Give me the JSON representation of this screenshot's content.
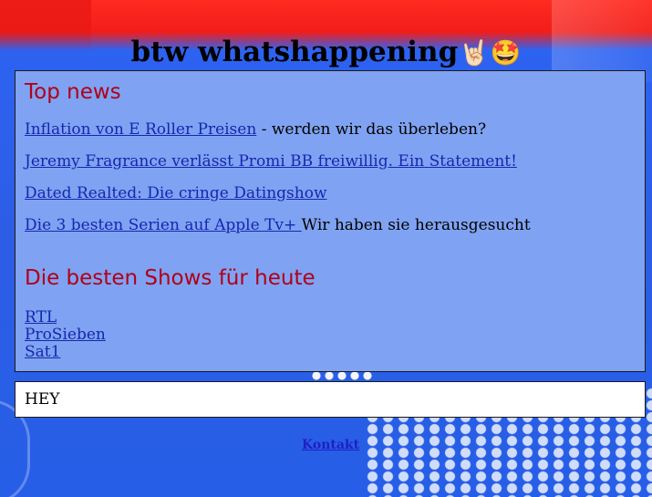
{
  "header": {
    "title": "btw whatshappening",
    "emoji_1": "🤘🏻",
    "emoji_2": "🤩"
  },
  "top_news": {
    "heading": "Top news",
    "items": [
      {
        "link": "Inflation von E Roller Preisen",
        "suffix": " - werden wir das überleben?"
      },
      {
        "link": "Jeremy Fragrance verlässt Promi BB freiwillig. Ein Statement!",
        "suffix": ""
      },
      {
        "link": "Dated Realted: Die cringe Datingshow",
        "suffix": ""
      },
      {
        "link": "Die 3 besten Serien auf Apple Tv+ ",
        "suffix": "Wir haben sie herausgesucht"
      }
    ]
  },
  "shows": {
    "heading": "Die besten Shows für heute",
    "items": [
      "RTL",
      "ProSieben",
      "Sat1"
    ]
  },
  "message_box": {
    "text": "HEY"
  },
  "footer": {
    "contact": "Kontakt"
  },
  "colors": {
    "header_background": "#f21d19",
    "page_background": "#2d5de4",
    "content_box": "#7fa3f2",
    "heading_red": "#b00018",
    "link_blue": "#1726b0"
  }
}
